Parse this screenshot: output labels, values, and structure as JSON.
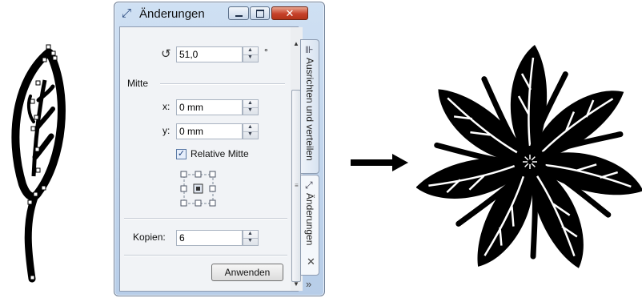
{
  "window": {
    "title": "Änderungen",
    "title_icon": "transform-icon",
    "buttons": {
      "minimize": "minimize-icon",
      "maximize": "maximize-icon",
      "close": "close-icon"
    }
  },
  "rotation": {
    "value": "51,0",
    "unit": "°"
  },
  "center": {
    "heading": "Mitte",
    "x_label": "x:",
    "x_value": "0 mm",
    "y_label": "y:",
    "y_value": "0 mm",
    "relative_label": "Relative Mitte",
    "relative_checked": true
  },
  "copies": {
    "label": "Kopien:",
    "value": "6"
  },
  "apply_label": "Anwenden",
  "tabs": {
    "align": "Ausrichten und verteilen",
    "transform": "Änderungen"
  },
  "colors": {
    "window_frame": "#b7cde8",
    "close_button": "#c6412a",
    "panel": "#f1f3f6",
    "ink": "#000000"
  }
}
